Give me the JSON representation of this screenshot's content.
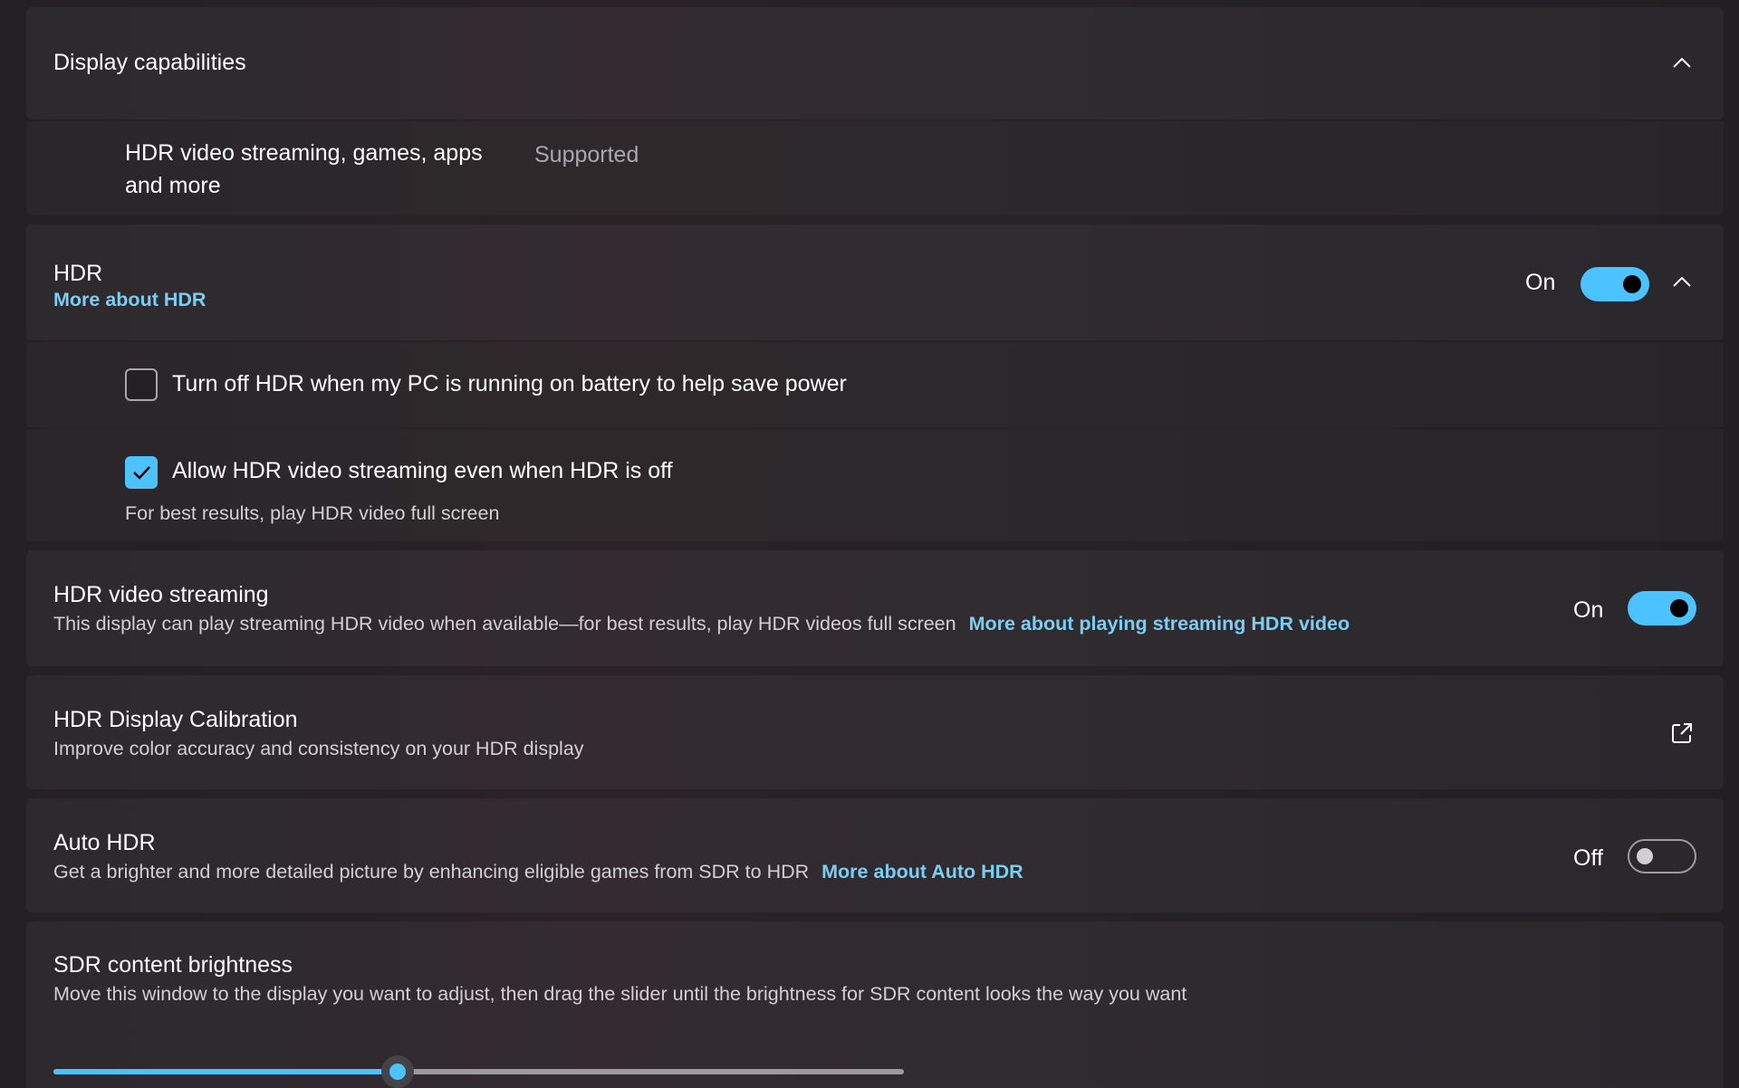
{
  "colors": {
    "accent": "#4cc2ff",
    "link": "#7ccdf3",
    "card_bg": "#2a2729",
    "text_secondary": "#d2d0d4"
  },
  "display_capabilities": {
    "title": "Display capabilities",
    "item_label_line1": "HDR video streaming, games, apps",
    "item_label_line2": "and more",
    "item_value": "Supported",
    "expanded": true
  },
  "hdr": {
    "title": "HDR",
    "link": "More about HDR",
    "state_label": "On",
    "enabled": true,
    "expanded": true,
    "battery_option": {
      "label": "Turn off HDR when my PC is running on battery to help save power",
      "checked": false
    },
    "streaming_option": {
      "label": "Allow HDR video streaming even when HDR is off",
      "checked": true,
      "hint": "For best results, play HDR video full screen"
    }
  },
  "hdr_video_streaming": {
    "title": "HDR video streaming",
    "description": "This display can play streaming HDR video when available—for best results, play HDR videos full screen",
    "link": "More about playing streaming HDR video",
    "state_label": "On",
    "enabled": true
  },
  "hdr_calibration": {
    "title": "HDR Display Calibration",
    "description": "Improve color accuracy and consistency on your HDR display",
    "icon": "external-link-icon"
  },
  "auto_hdr": {
    "title": "Auto HDR",
    "description": "Get a brighter and more detailed picture by enhancing eligible games from SDR to HDR",
    "link": "More about Auto HDR",
    "state_label": "Off",
    "enabled": false
  },
  "sdr_brightness": {
    "title": "SDR content brightness",
    "description": "Move this window to the display you want to adjust, then drag the slider until the brightness for SDR content looks the way you want",
    "value_fraction": 0.405
  }
}
